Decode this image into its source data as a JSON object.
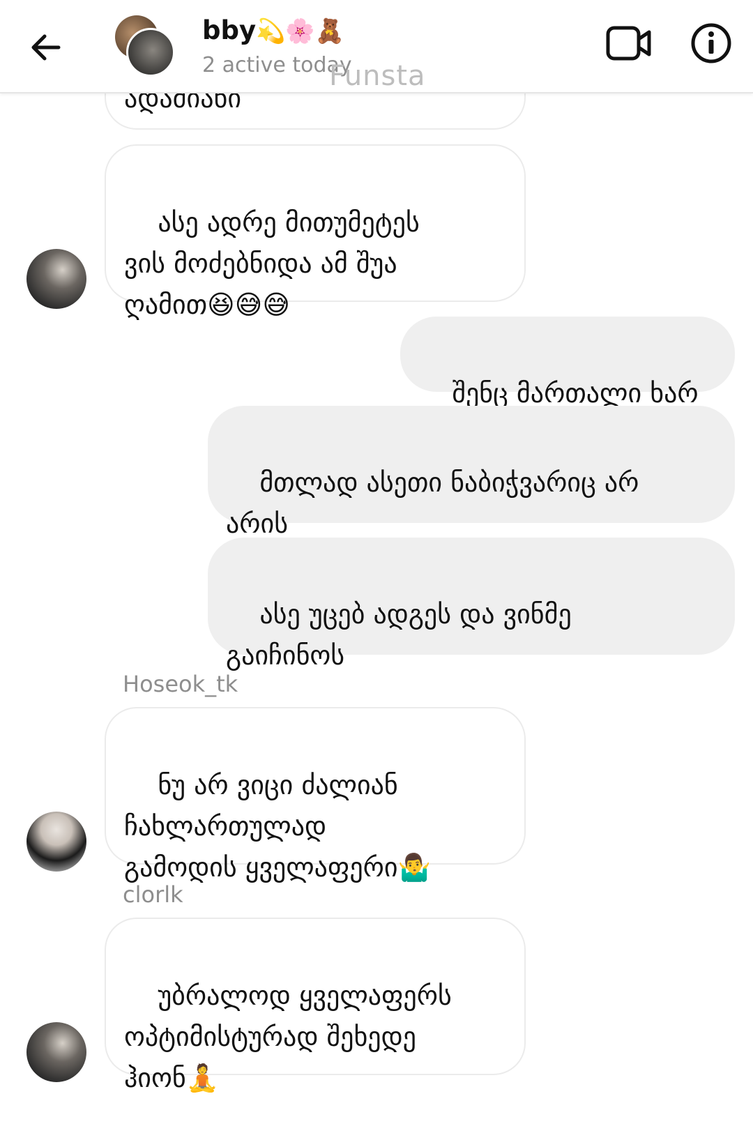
{
  "header": {
    "title": "bby",
    "title_emoji": "💫🌸🧸",
    "status": "2 active today",
    "watermark": "Funsta"
  },
  "messages": [
    {
      "id": "m0",
      "side": "incoming",
      "text": "ადამიანი",
      "partial": true
    },
    {
      "id": "m1",
      "side": "incoming",
      "text": "ასე ადრე მითუმეტეს\nვის მოძებნიდა ამ შუა\nღამით😆😅😅"
    },
    {
      "id": "m2",
      "side": "outgoing",
      "text": "შენც მართალი ხარ"
    },
    {
      "id": "m3",
      "side": "outgoing",
      "text": "მთლად ასეთი ნაბიჭვარიც არ\nარის"
    },
    {
      "id": "m4",
      "side": "outgoing",
      "text": "ასე უცებ ადგეს და ვინმე\nგაიჩინოს"
    },
    {
      "id": "m5",
      "side": "incoming",
      "sender": "Hoseok_tk",
      "text": "ნუ არ ვიცი ძალიან\nჩახლართულად\nგამოდის ყველაფერი🤷‍♂️"
    },
    {
      "id": "m6",
      "side": "incoming",
      "sender": "clorlk",
      "text": "უბრალოდ ყველაფერს\nოპტიმისტურად შეხედე\nჰიონ🧘"
    }
  ],
  "colors": {
    "outgoing_bubble": "#efefef",
    "incoming_border": "#ebebeb",
    "secondary_text": "#8e8e8e"
  },
  "icons": [
    "back-arrow-icon",
    "video-call-icon",
    "info-icon"
  ]
}
